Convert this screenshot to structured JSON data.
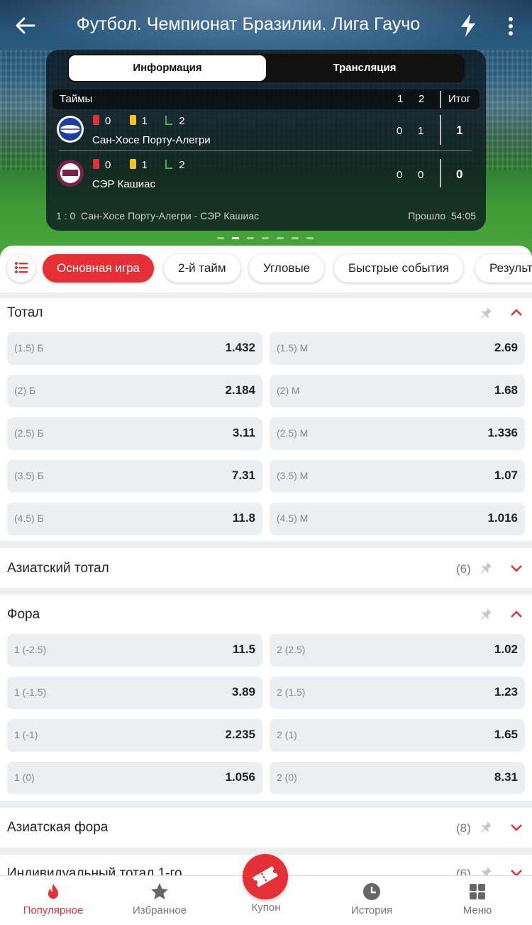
{
  "header": {
    "title": "Футбол. Чемпионат Бразилии. Лига Гаучо"
  },
  "scoreboard": {
    "tabs": [
      "Информация",
      "Трансляция"
    ],
    "periods_label": "Таймы",
    "period1": "1",
    "period2": "2",
    "total_label": "Итог",
    "teams": [
      {
        "name": "Сан-Хосе Порту-Алегри",
        "red": "0",
        "yellow": "1",
        "corners": "2",
        "p1": "0",
        "p2": "1",
        "total": "1"
      },
      {
        "name": "СЭР Кашиас",
        "red": "0",
        "yellow": "1",
        "corners": "2",
        "p1": "0",
        "p2": "0",
        "total": "0"
      }
    ],
    "live_text": "1 : 0  Сан-Хосе Порту-Алегри - СЭР Кашиас",
    "elapsed": "Прошло  54:05"
  },
  "chips": [
    "Основная игра",
    "2-й тайм",
    "Угловые",
    "Быстрые события",
    "Результ"
  ],
  "markets": {
    "total": {
      "title": "Тотал",
      "rows": [
        [
          "(1.5) Б",
          "1.432",
          "(1.5) М",
          "2.69"
        ],
        [
          "(2) Б",
          "2.184",
          "(2) М",
          "1.68"
        ],
        [
          "(2.5) Б",
          "3.11",
          "(2.5) М",
          "1.336"
        ],
        [
          "(3.5) Б",
          "7.31",
          "(3.5) М",
          "1.07"
        ],
        [
          "(4.5) Б",
          "11.8",
          "(4.5) М",
          "1.016"
        ]
      ]
    },
    "asian_total": {
      "title": "Азиатский тотал",
      "count": "(6)"
    },
    "handicap": {
      "title": "Фора",
      "rows": [
        [
          "1 (-2.5)",
          "11.5",
          "2 (2.5)",
          "1.02"
        ],
        [
          "1 (-1.5)",
          "3.89",
          "2 (1.5)",
          "1.23"
        ],
        [
          "1 (-1)",
          "2.235",
          "2 (1)",
          "1.65"
        ],
        [
          "1 (0)",
          "1.056",
          "2 (0)",
          "8.31"
        ]
      ]
    },
    "asian_handicap": {
      "title": "Азиатская фора",
      "count": "(8)"
    },
    "ind_total": {
      "title": "Индивидуальный тотал 1-го",
      "count": "(6)"
    }
  },
  "bottom_nav": [
    "Популярное",
    "Избранное",
    "Купон",
    "История",
    "Меню"
  ],
  "colors": {
    "accent": "#e52f36"
  }
}
